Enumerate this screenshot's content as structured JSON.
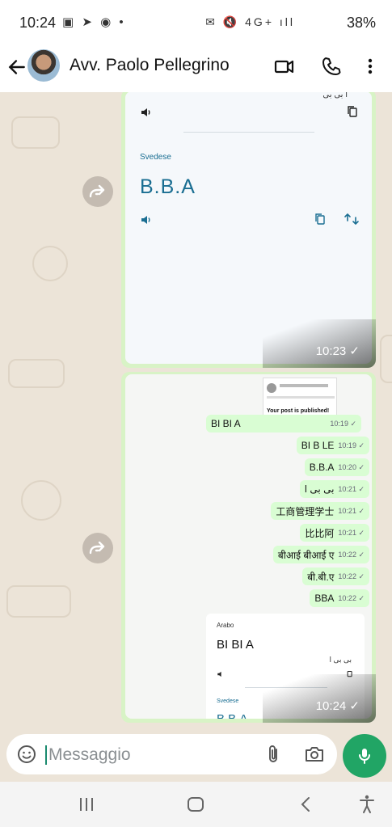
{
  "status_bar": {
    "time": "10:24",
    "left_icons": "▣ ➤ ◉ •",
    "right_icons": "✉ 🔇 4G+ ıll",
    "battery": "38%"
  },
  "header": {
    "contact_name": "Avv. Paolo Pellegrino"
  },
  "card1": {
    "top_fragment": "ا بی بی",
    "language_label": "Svedese",
    "translation": "B.B.A",
    "time": "10:23 ✓"
  },
  "card2": {
    "post_thumb_text": "Your post is published!",
    "messages": [
      {
        "text": "BI BI A",
        "time": "10:19 ✓"
      },
      {
        "text": "BI B LE",
        "time": "10:19 ✓"
      },
      {
        "text": "B.B.A",
        "time": "10:20 ✓"
      },
      {
        "text": "بی بی ا",
        "time": "10:21 ✓"
      },
      {
        "text": "工商管理学士",
        "time": "10:21 ✓"
      },
      {
        "text": "比比阿",
        "time": "10:21 ✓"
      },
      {
        "text": "बीआई बीआई ए",
        "time": "10:22 ✓"
      },
      {
        "text": "बी.बी.ए",
        "time": "10:22 ✓"
      },
      {
        "text": "BBA",
        "time": "10:22 ✓"
      }
    ],
    "inner_card": {
      "source_label": "Arabo",
      "source_text": "BI BI A",
      "arabic": "بی بی ا",
      "target_label": "Svedese",
      "target_text": "B.B.A"
    },
    "time": "10:24 ✓"
  },
  "input": {
    "placeholder": "Messaggio"
  },
  "icons": {
    "back": "arrow-left",
    "video": "video-camera",
    "call": "phone",
    "menu": "more-vertical",
    "forward": "forward-arrow",
    "speaker": "speaker",
    "copy": "copy",
    "swap": "swap",
    "emoji": "emoji",
    "attach": "paperclip",
    "camera": "camera",
    "mic": "microphone",
    "recents": "recents",
    "home": "home",
    "nav_back": "chevron-left",
    "accessibility": "accessibility"
  },
  "colors": {
    "mic": "#21a565",
    "bubble_border": "#d8f3c6",
    "translation": "#1a6e92",
    "wallpaper": "#ece4d8"
  }
}
